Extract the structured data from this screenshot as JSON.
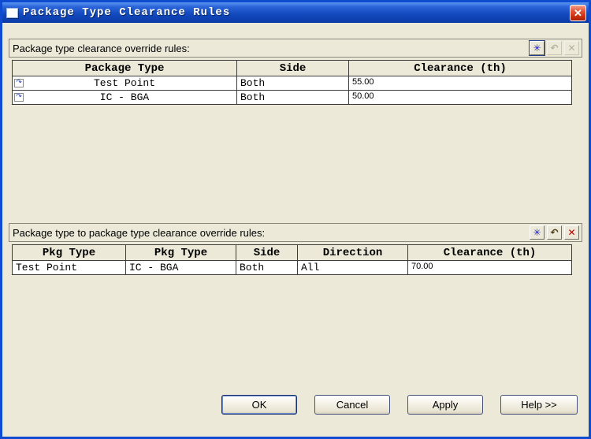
{
  "window": {
    "title": "Package Type Clearance Rules"
  },
  "icons": {
    "close": "✕",
    "add": "✳",
    "undo": "↶",
    "delete": "✕",
    "row_marker": "↷"
  },
  "section1": {
    "label": "Package type clearance override rules:",
    "table": {
      "headers": [
        "Package Type",
        "Side",
        "Clearance (th)"
      ],
      "rows": [
        {
          "package_type": "Test Point",
          "side": "Both",
          "clearance": "55.00"
        },
        {
          "package_type": "IC - BGA",
          "side": "Both",
          "clearance": "50.00"
        }
      ]
    }
  },
  "section2": {
    "label": "Package type to package type clearance override rules:",
    "table": {
      "headers": [
        "Pkg Type",
        "Pkg Type",
        "Side",
        "Direction",
        "Clearance (th)"
      ],
      "rows": [
        {
          "pkg_type_1": "Test Point",
          "pkg_type_2": "IC - BGA",
          "side": "Both",
          "direction": "All",
          "clearance": "70.00"
        }
      ]
    }
  },
  "buttons": {
    "ok": "OK",
    "cancel": "Cancel",
    "apply": "Apply",
    "help": "Help >>"
  },
  "colors": {
    "titlebar_blue": "#1148bc",
    "dialog_bg": "#ECE9D8",
    "close_red": "#cc3411",
    "add_blue": "#1b1bd6",
    "delete_red": "#b40000"
  }
}
